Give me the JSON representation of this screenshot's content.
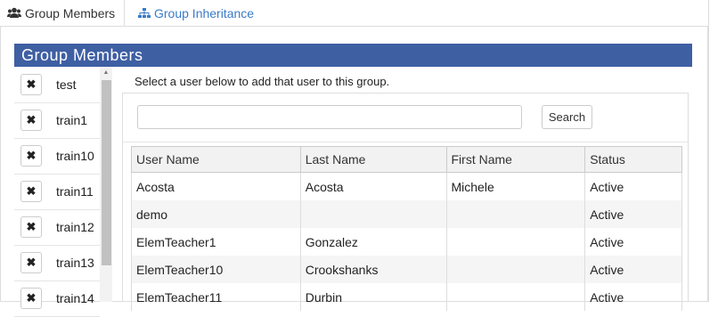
{
  "tabs": [
    {
      "label": "Group Members",
      "icon": "users-icon",
      "active": true
    },
    {
      "label": "Group Inheritance",
      "icon": "sitemap-icon",
      "active": false
    }
  ],
  "panel": {
    "title": "Group Members"
  },
  "members": [
    {
      "name": "test"
    },
    {
      "name": "train1"
    },
    {
      "name": "train10"
    },
    {
      "name": "train11"
    },
    {
      "name": "train12"
    },
    {
      "name": "train13"
    },
    {
      "name": "train14"
    }
  ],
  "add_user": {
    "instruction": "Select a user below to add that user to this group.",
    "search_value": "",
    "search_button": "Search"
  },
  "table": {
    "columns": [
      "User Name",
      "Last Name",
      "First Name",
      "Status"
    ],
    "rows": [
      [
        "Acosta",
        "Acosta",
        "Michele",
        "Active"
      ],
      [
        "demo",
        "",
        "",
        "Active"
      ],
      [
        "ElemTeacher1",
        "Gonzalez",
        "",
        "Active"
      ],
      [
        "ElemTeacher10",
        "Crookshanks",
        "",
        "Active"
      ],
      [
        "ElemTeacher11",
        "Durbin",
        "",
        "Active"
      ]
    ]
  },
  "colors": {
    "header_bg": "#3f5fa3",
    "link": "#3a7bc8"
  }
}
